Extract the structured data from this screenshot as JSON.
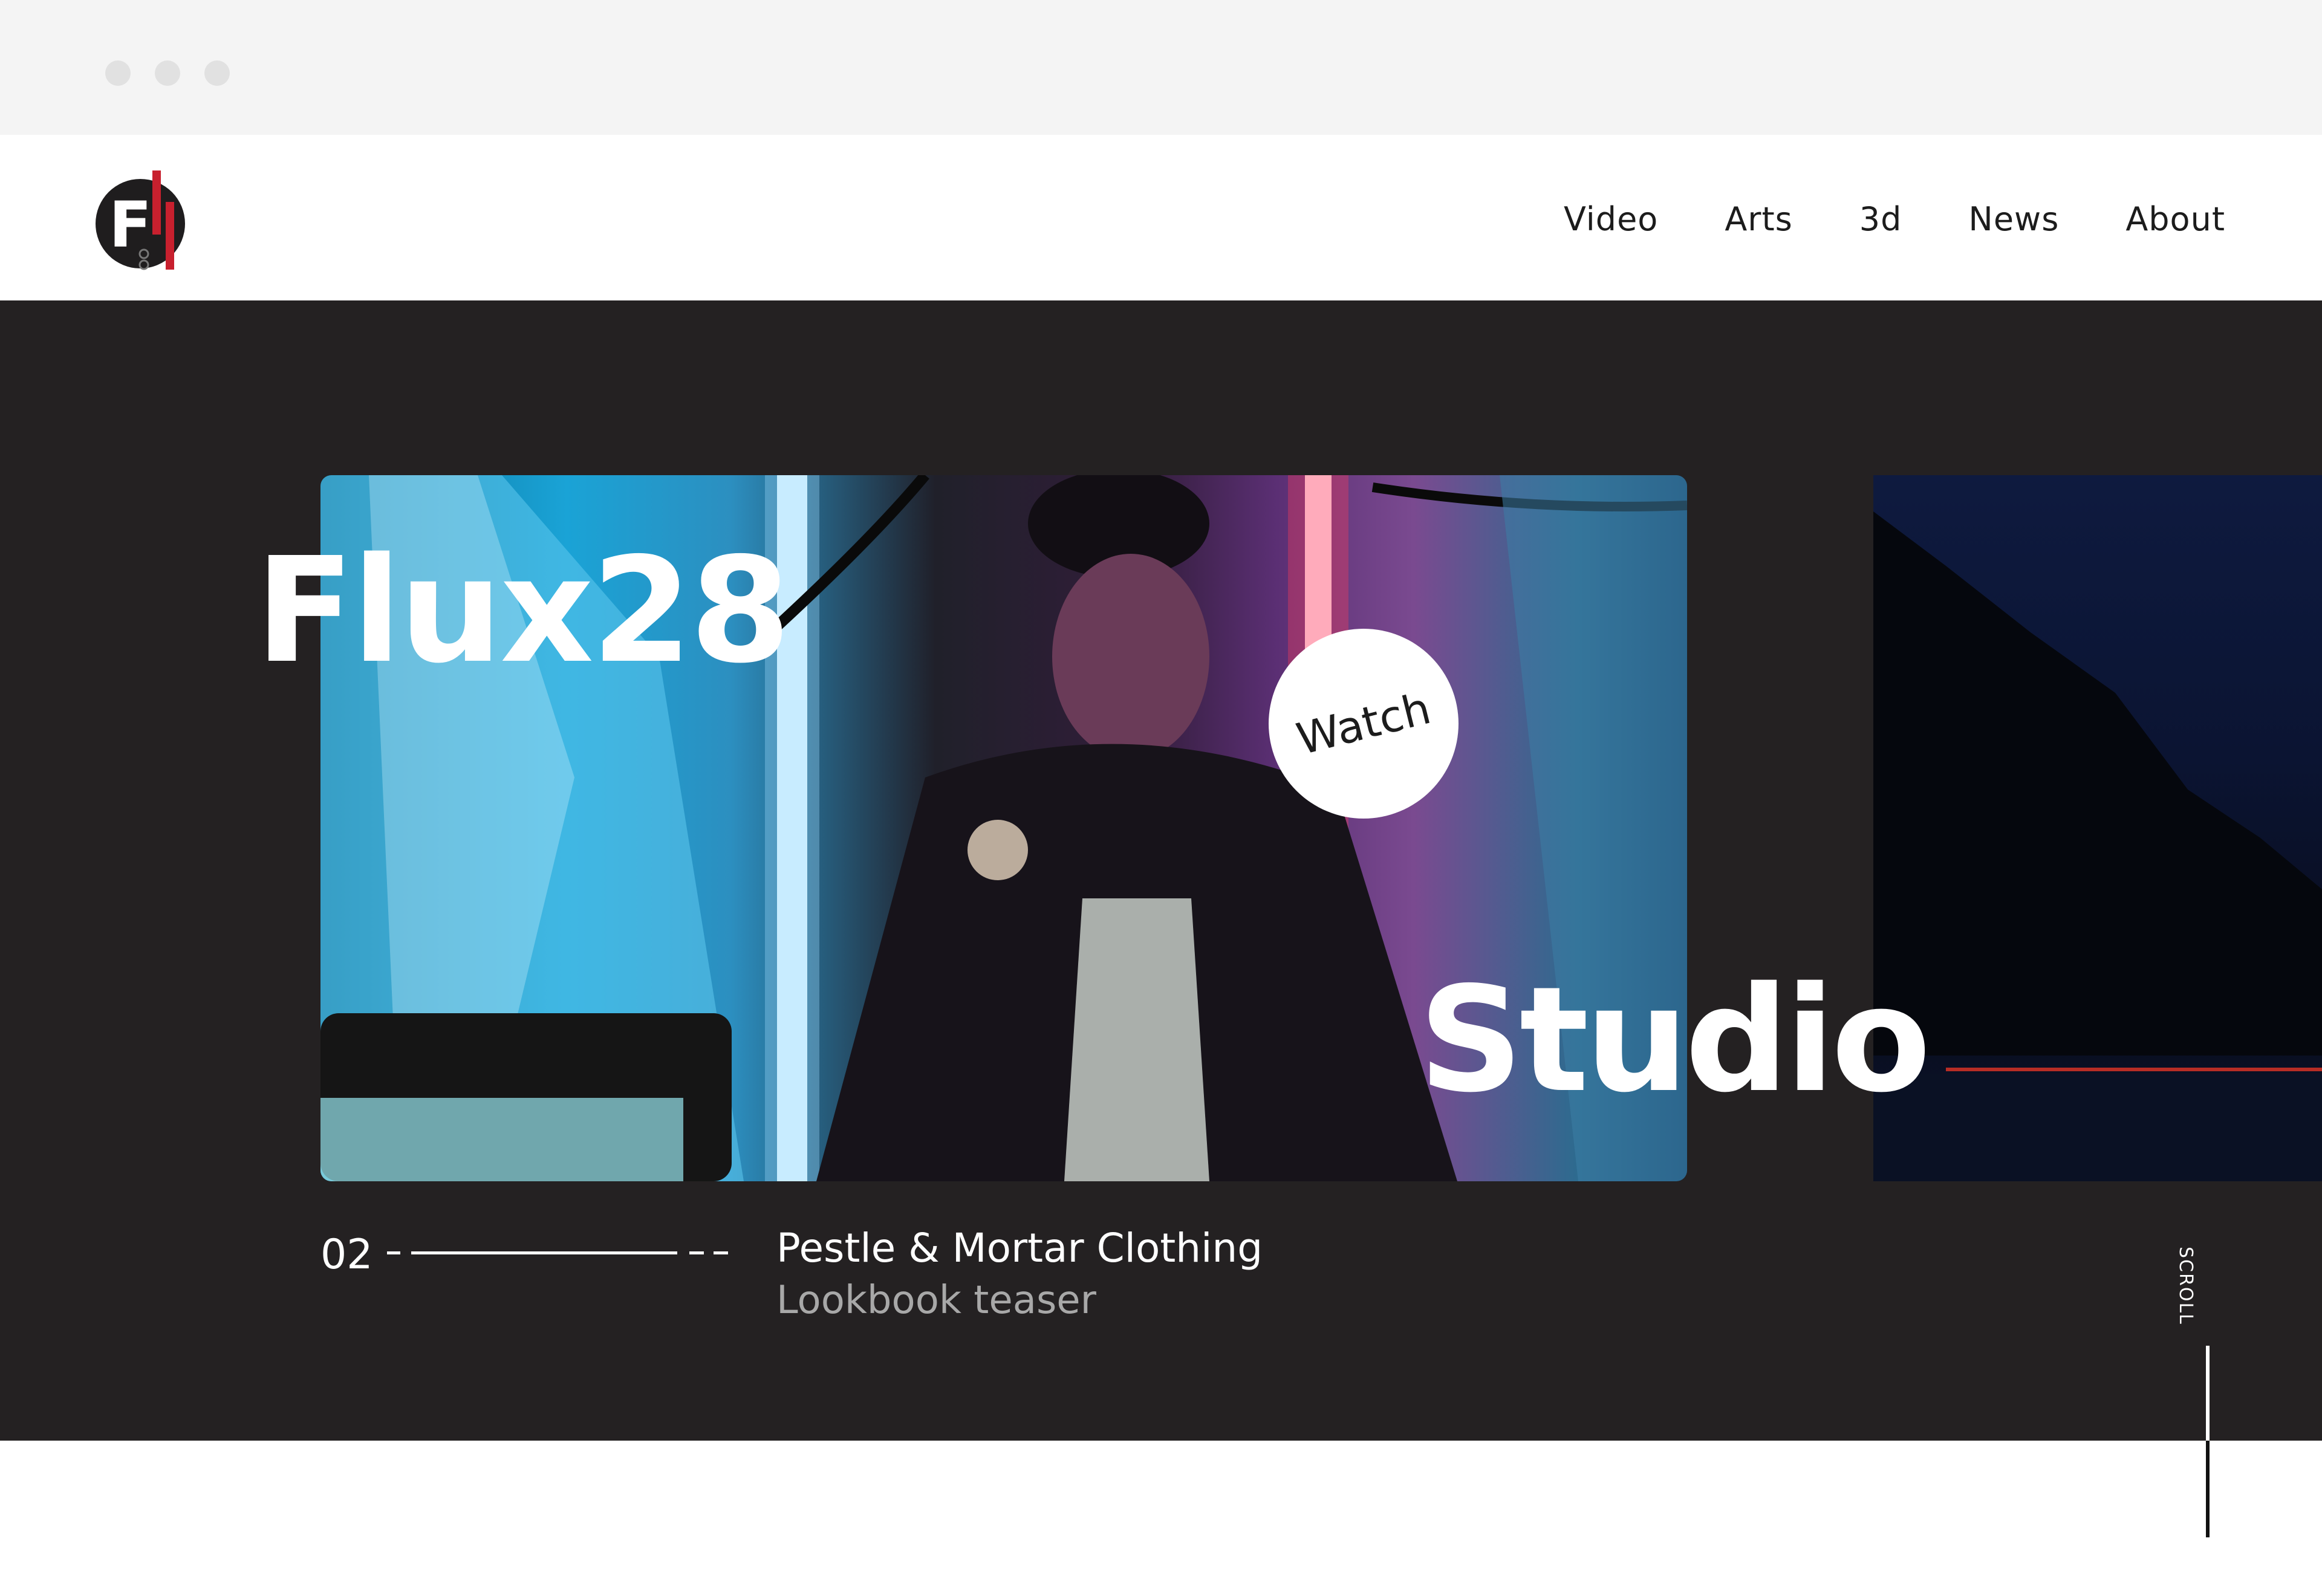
{
  "window": {
    "controls": [
      "close",
      "minimize",
      "maximize"
    ]
  },
  "header": {
    "logo_icon": "flux28-logo-icon",
    "logo_text": "F",
    "nav": [
      {
        "label": "Video"
      },
      {
        "label": "Arts"
      },
      {
        "label": "3d"
      },
      {
        "label": "News"
      },
      {
        "label": "About"
      }
    ]
  },
  "hero": {
    "title_line1": "Flux28",
    "title_line2": "Studio",
    "watch_label": "Watch",
    "slide_index": "02",
    "project_title": "Pestle & Mortar Clothing",
    "project_subtitle": "Lookbook teaser",
    "scroll_label": "SCROLL"
  },
  "colors": {
    "hero_bg": "#242122",
    "accent_red": "#c8202e",
    "text_white": "#ffffff",
    "text_muted": "#a8a8a8"
  }
}
